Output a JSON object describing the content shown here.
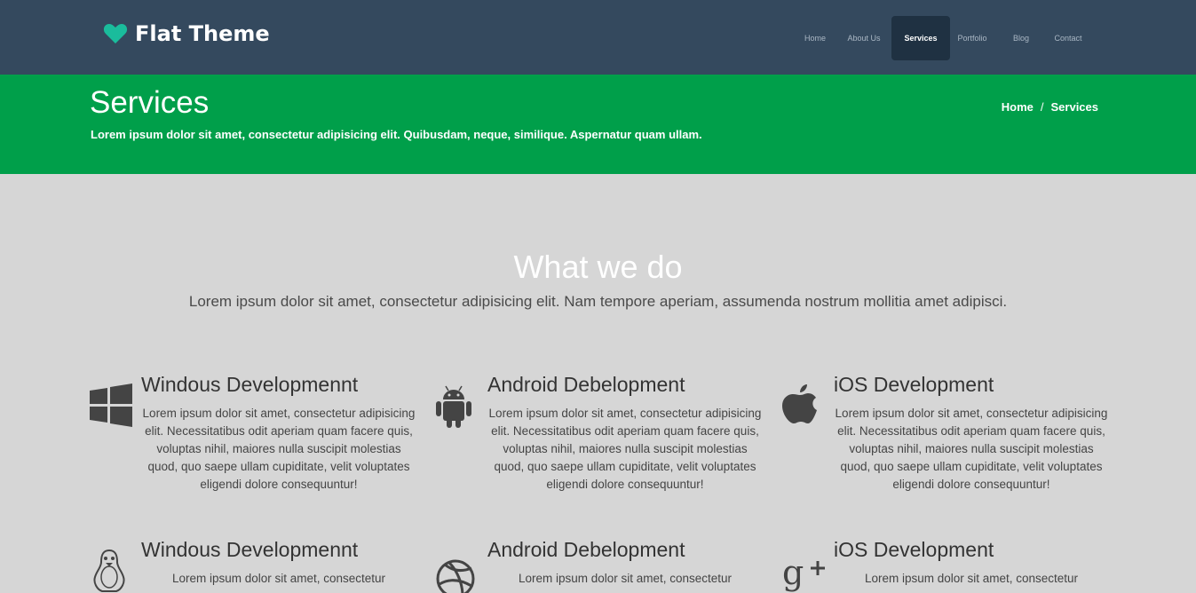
{
  "brand": {
    "name": "Flat Theme",
    "icon": "heart-icon",
    "icon_color": "#1abc9c"
  },
  "nav": {
    "items": [
      {
        "label": "Home",
        "active": false
      },
      {
        "label": "About Us",
        "active": false
      },
      {
        "label": "Services",
        "active": true
      },
      {
        "label": "Portfolio",
        "active": false
      },
      {
        "label": "Blog",
        "active": false
      },
      {
        "label": "Contact",
        "active": false
      }
    ]
  },
  "banner": {
    "title": "Services",
    "subtitle": "Lorem ipsum dolor sit amet, consectetur adipisicing elit. Quibusdam, neque, similique. Aspernatur quam ullam.",
    "breadcrumb": {
      "home": "Home",
      "sep": "/",
      "current": "Services"
    },
    "color": "#009f4a"
  },
  "section": {
    "title": "What we do",
    "subtitle": "Lorem ipsum dolor sit amet, consectetur adipisicing elit. Nam tempore aperiam, assumenda nostrum mollitia amet adipisci."
  },
  "services": [
    {
      "icon": "windows-icon",
      "title": "Windous Developmennt",
      "text": "Lorem ipsum dolor sit amet, consectetur adipisicing elit. Necessitatibus odit aperiam quam facere quis, voluptas nihil, maiores nulla suscipit molestias quod, quo saepe ullam cupiditate, velit voluptates eligendi dolore consequuntur!"
    },
    {
      "icon": "android-icon",
      "title": "Android Debelopment",
      "text": "Lorem ipsum dolor sit amet, consectetur adipisicing elit. Necessitatibus odit aperiam quam facere quis, voluptas nihil, maiores nulla suscipit molestias quod, quo saepe ullam cupiditate, velit voluptates eligendi dolore consequuntur!"
    },
    {
      "icon": "apple-icon",
      "title": "iOS Development",
      "text": "Lorem ipsum dolor sit amet, consectetur adipisicing elit. Necessitatibus odit aperiam quam facere quis, voluptas nihil, maiores nulla suscipit molestias quod, quo saepe ullam cupiditate, velit voluptates eligendi dolore consequuntur!"
    },
    {
      "icon": "linux-icon",
      "title": "Windous Developmennt",
      "text": "Lorem ipsum dolor sit amet, consectetur"
    },
    {
      "icon": "dribbble-icon",
      "title": "Android Debelopment",
      "text": "Lorem ipsum dolor sit amet, consectetur"
    },
    {
      "icon": "google-plus-icon",
      "title": "iOS Development",
      "text": "Lorem ipsum dolor sit amet, consectetur"
    }
  ]
}
